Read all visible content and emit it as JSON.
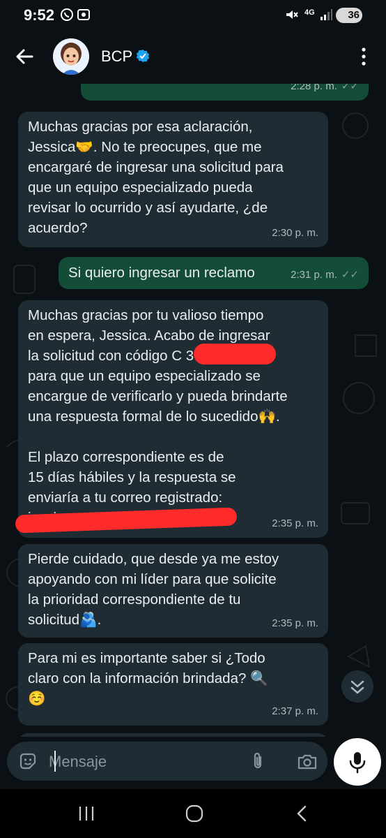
{
  "status_bar": {
    "time": "9:52",
    "network": "4G",
    "battery": "36"
  },
  "header": {
    "contact_name": "BCP",
    "icons": [
      "back-arrow-icon",
      "avatar",
      "verified-badge-icon",
      "more-options-icon"
    ]
  },
  "messages": [
    {
      "direction": "out",
      "text": "",
      "time": "2:28 p. m.",
      "ticks": "✓✓"
    },
    {
      "direction": "in",
      "text": "Muchas gracias por esa aclaración,\nJessica🤝. No te preocupes, que me\nencargaré de ingresar una solicitud para\nque un equipo especializado pueda\nrevisar lo ocurrido y así ayudarte, ¿de\nacuerdo?",
      "time": "2:30 p. m."
    },
    {
      "direction": "out",
      "text": "Si quiero ingresar un reclamo",
      "time": "2:31 p. m.",
      "ticks": "✓✓"
    },
    {
      "direction": "in",
      "text": "Muchas gracias por tu valioso tiempo\nen espera, Jessica. Acabo de ingresar\nla solicitud con código C           3\npara que un equipo especializado se\nencargue de verificarlo y pueda brindarte\nuna respuesta formal de lo sucedido🙌.\n\nEl plazo correspondiente es de\n15 días hábiles y la respuesta se\nenviaría a tu correo registrado:\njessica.",
      "time": "2:35 p. m."
    },
    {
      "direction": "in",
      "text": "Pierde cuidado, que desde ya me estoy\napoyando con mi líder para que solicite\nla prioridad correspondiente de tu\nsolicitud🫂.",
      "time": "2:35 p. m."
    },
    {
      "direction": "in",
      "text": "Para mi es importante saber si ¿Todo\nclaro con la información brindada? 🔍\n☺️",
      "time": "2:37 p. m."
    }
  ],
  "composer": {
    "placeholder": "Mensaje"
  },
  "colors": {
    "background": "#0b1014",
    "incoming_bubble": "#202c33",
    "outgoing_bubble": "#144d37",
    "accent": "#25d366"
  }
}
